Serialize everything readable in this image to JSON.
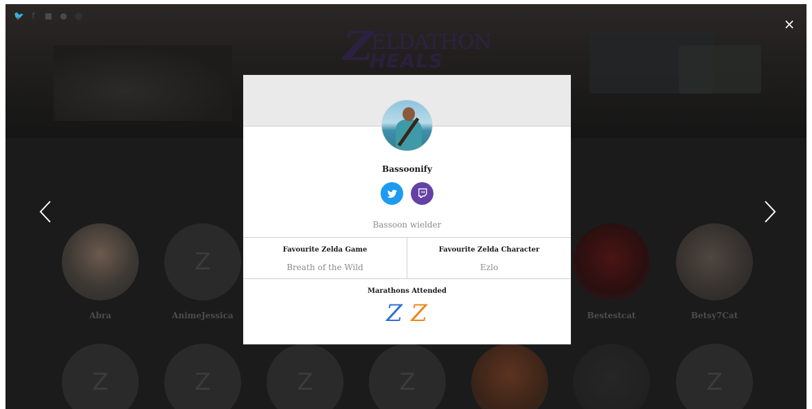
{
  "header": {
    "logo_letter": "Z",
    "logo_line1": "ELDATHON",
    "logo_line2": "HEALS",
    "social_icons": [
      "twitter-icon",
      "facebook-icon",
      "discord-icon",
      "twitch-icon",
      "instagram-icon"
    ]
  },
  "close_label": "×",
  "grid": {
    "placeholder_letter": "Z",
    "names": [
      "Abra",
      "AnimeJessica",
      "Bestestcat",
      "Betsy7Cat"
    ]
  },
  "modal": {
    "username": "Bassoonify",
    "bio": "Bassoon wielder",
    "fav_game_title": "Favourite Zelda Game",
    "fav_game_value": "Breath of the Wild",
    "fav_char_title": "Favourite Zelda Character",
    "fav_char_value": "Ezlo",
    "marathons_title": "Marathons Attended",
    "badges": [
      "Z",
      "Z"
    ],
    "colors": {
      "twitter": "#1d9bf0",
      "twitch": "#6441a5",
      "badge_blue": "#2f6fd6",
      "badge_orange": "#e9871b"
    }
  }
}
